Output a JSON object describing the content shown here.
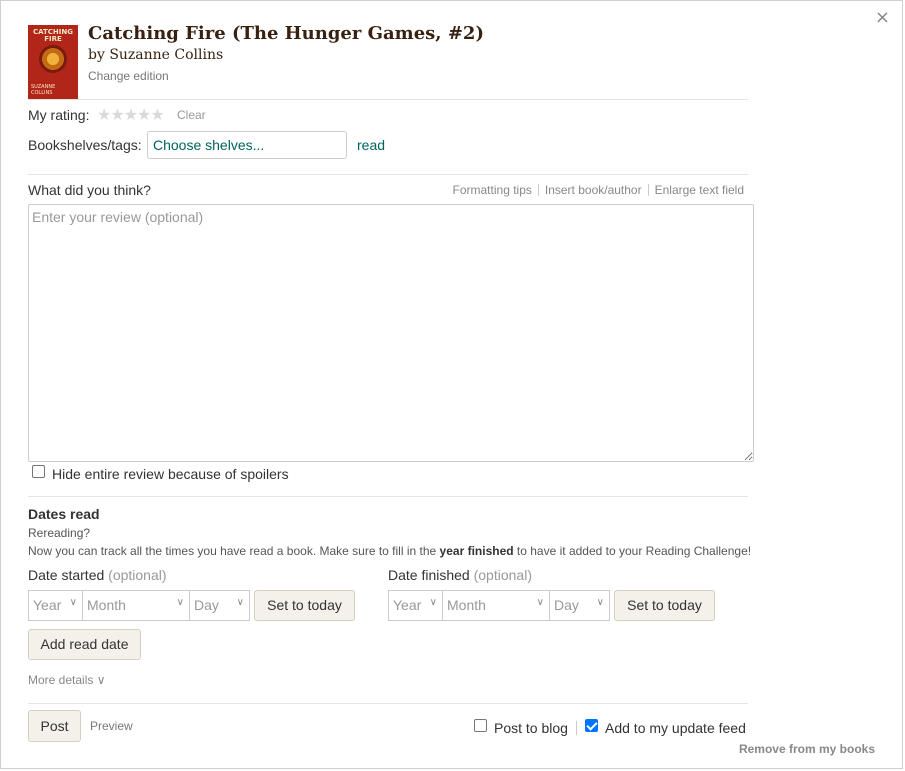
{
  "close_label": "×",
  "book": {
    "cover_title": "CATCHING FIRE",
    "cover_author": "SUZANNE COLLINS",
    "title": "Catching Fire (The Hunger Games, #2)",
    "author_line": "by Suzanne Collins",
    "change_edition": "Change edition"
  },
  "rating": {
    "label": "My rating:",
    "stars": "★★★★★",
    "value": 0,
    "clear": "Clear"
  },
  "shelves": {
    "label": "Bookshelves/tags:",
    "input_value": "Choose shelves...",
    "current_shelf": "read"
  },
  "review": {
    "label": "What did you think?",
    "tools": [
      "Formatting tips",
      "Insert book/author",
      "Enlarge text field"
    ],
    "placeholder": "Enter your review (optional)",
    "spoiler_label": "Hide entire review because of spoilers",
    "spoiler_checked": false
  },
  "dates": {
    "heading": "Dates read",
    "rereading": "Rereading?",
    "info_prefix": "Now you can track all the times you have read a book. Make sure to fill in the ",
    "info_bold": "year finished",
    "info_suffix": " to have it added to your Reading Challenge!",
    "started_label": "Date started",
    "finished_label": "Date finished",
    "optional": "(optional)",
    "year_placeholder": "Year",
    "month_placeholder": "Month",
    "day_placeholder": "Day",
    "set_today": "Set to today",
    "add_read_date": "Add read date",
    "chevron": "∨"
  },
  "more_details": "More details ∨",
  "footer": {
    "post": "Post",
    "preview": "Preview",
    "post_to_blog": "Post to blog",
    "post_to_blog_checked": false,
    "add_to_feed": "Add to my update feed",
    "add_to_feed_checked": true,
    "remove": "Remove from my books"
  }
}
